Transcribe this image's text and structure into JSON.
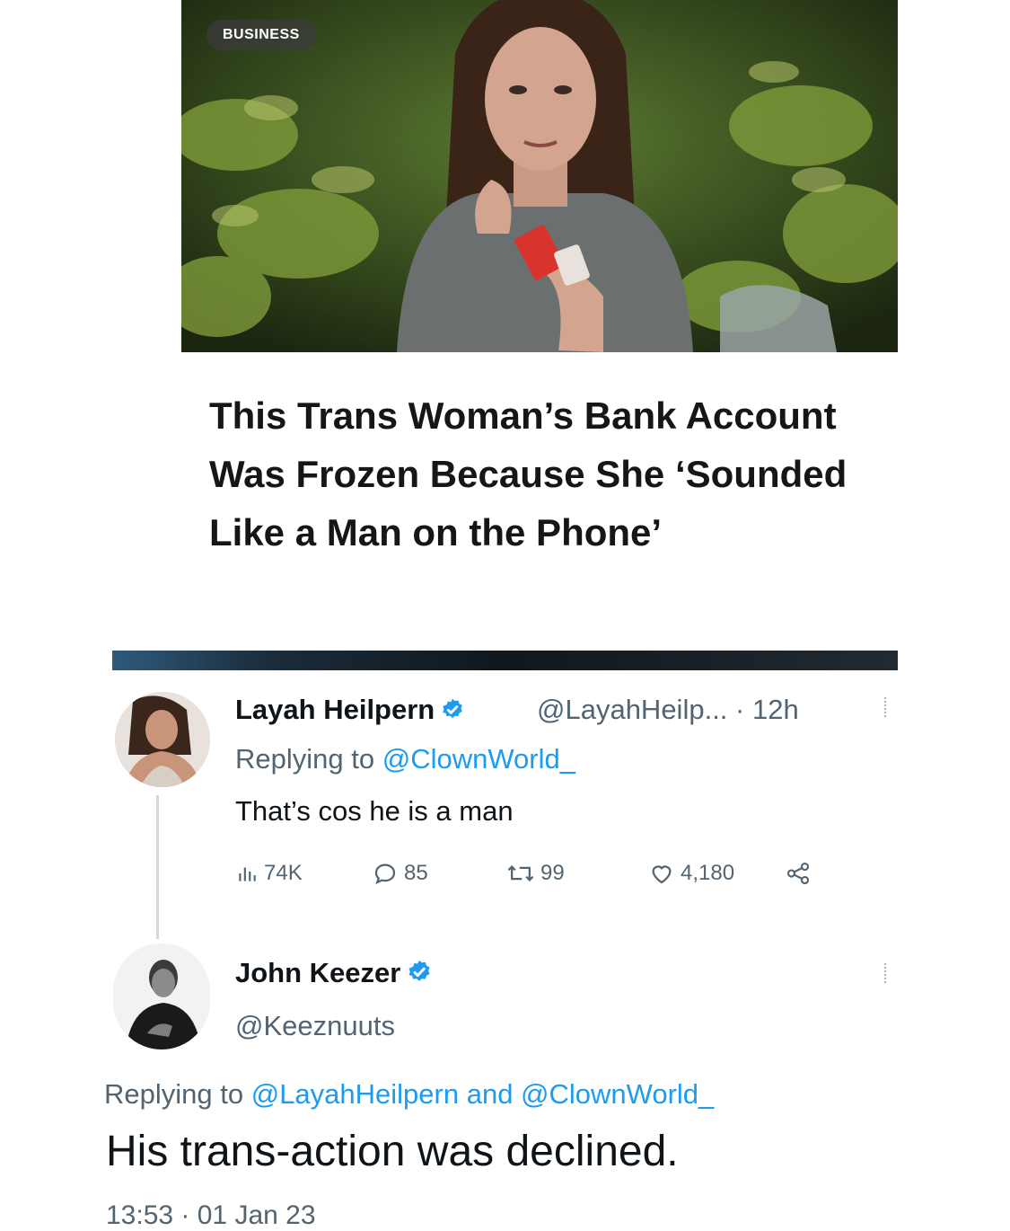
{
  "article": {
    "section_label": "BUSINESS",
    "headline": "This Trans Woman’s Bank Account Was Frozen Because She ‘Sounded Like a Man on the Phone’"
  },
  "tweet1": {
    "display_name": "Layah Heilpern",
    "handle_time": "@LayahHeilp... · 12h",
    "replying_prefix": "Replying to ",
    "replying_handle": "@ClownWorld_",
    "text": "That’s cos he is a man",
    "stats": {
      "views": "74K",
      "replies": "85",
      "retweets": "99",
      "likes": "4,180"
    }
  },
  "tweet2": {
    "display_name": "John Keezer",
    "handle": "@Keeznuuts",
    "replying_prefix": "Replying to ",
    "replying_handles": "@LayahHeilpern and @ClownWorld_",
    "text": "His trans-action was declined.",
    "timestamp": "13:53 · 01 Jan 23"
  },
  "colors": {
    "accent_blue": "#1d9bf0",
    "muted_text": "#536471",
    "primary_text": "#0f1419"
  },
  "icons": [
    "verified-badge-icon",
    "views-icon",
    "reply-icon",
    "retweet-icon",
    "like-icon",
    "share-icon",
    "more-icon"
  ]
}
